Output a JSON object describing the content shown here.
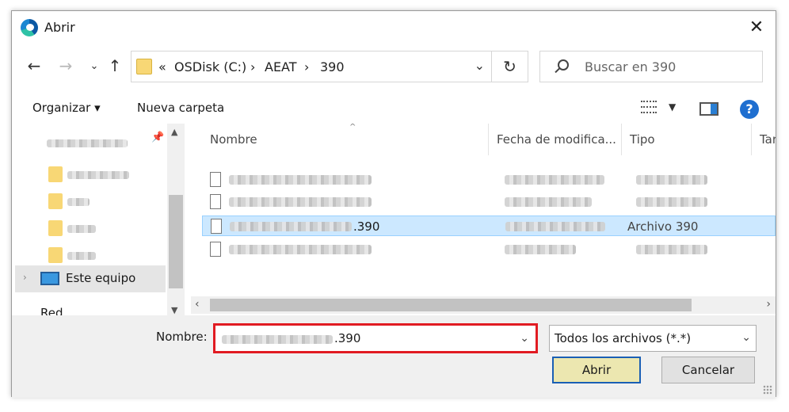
{
  "window": {
    "title": "Abrir",
    "close_glyph": "✕"
  },
  "address": {
    "prefix": "«",
    "crumbs": [
      "OSDisk (C:)",
      "AEAT",
      "390"
    ],
    "separator": "›",
    "dropdown_glyph": "⌄"
  },
  "nav_glyphs": {
    "back": "←",
    "forward": "→",
    "recent": "⌄",
    "up": "↑",
    "refresh": "↻"
  },
  "search": {
    "placeholder": "Buscar en 390"
  },
  "toolbar": {
    "organize": "Organizar ▾",
    "new_folder": "Nueva carpeta",
    "help": "?"
  },
  "navpane": {
    "this_pc": "Este equipo",
    "network_partial": "Red",
    "expander": "›"
  },
  "columns": [
    "Nombre",
    "Fecha de modifica...",
    "Tipo",
    "Tar"
  ],
  "files": [
    {
      "ext": "",
      "type": "",
      "selected": false
    },
    {
      "ext": "",
      "type": "",
      "selected": false
    },
    {
      "ext": ".390",
      "type": "Archivo 390",
      "selected": true
    },
    {
      "ext": "",
      "type": "",
      "selected": false
    }
  ],
  "filename": {
    "label": "Nombre:",
    "ext": ".390"
  },
  "filter": {
    "value": "Todos los archivos (*.*)"
  },
  "buttons": {
    "open": "Abrir",
    "cancel": "Cancelar"
  },
  "colors": {
    "selection": "#cce8ff",
    "highlight_border": "#e11b22",
    "open_button": "#ece7b0"
  }
}
